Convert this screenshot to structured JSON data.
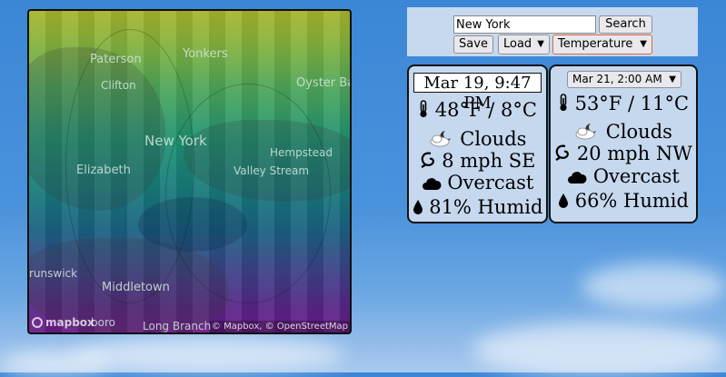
{
  "search": {
    "value": "New York",
    "button": "Search"
  },
  "toolbar": {
    "save": "Save",
    "load": "Load",
    "layer": "Temperature"
  },
  "map": {
    "labels": {
      "paterson": "Paterson",
      "yonkers": "Yonkers",
      "oyster_bay": "Oyster Ba",
      "clifton": "Clifton",
      "new_york": "New York",
      "hempstead": "Hempstead",
      "elizabeth": "Elizabeth",
      "valley_stream": "Valley Stream",
      "brunswick": "runswick",
      "middletown": "Middletown",
      "marlboro": "boro",
      "long_branch": "Long Branch"
    },
    "logo": "mapbox",
    "attribution": "© Mapbox, © OpenStreetMap"
  },
  "current": {
    "datetime": "Mar 19, 9:47 PM",
    "temp": "48°F / 8°C",
    "condition": "Clouds",
    "wind": "8 mph SE",
    "sky": "Overcast",
    "humidity": "81% Humid"
  },
  "forecast": {
    "datetime": "Mar 21, 2:00 AM",
    "temp": "53°F / 11°C",
    "condition": "Clouds",
    "wind": "20 mph NW",
    "sky": "Overcast",
    "humidity": "66% Humid"
  },
  "icons": {
    "temp": "thermometer-icon",
    "condition": "moon-clouds-icon",
    "wind": "wind-icon",
    "sky": "cloud-icon",
    "humidity": "droplet-icon"
  }
}
